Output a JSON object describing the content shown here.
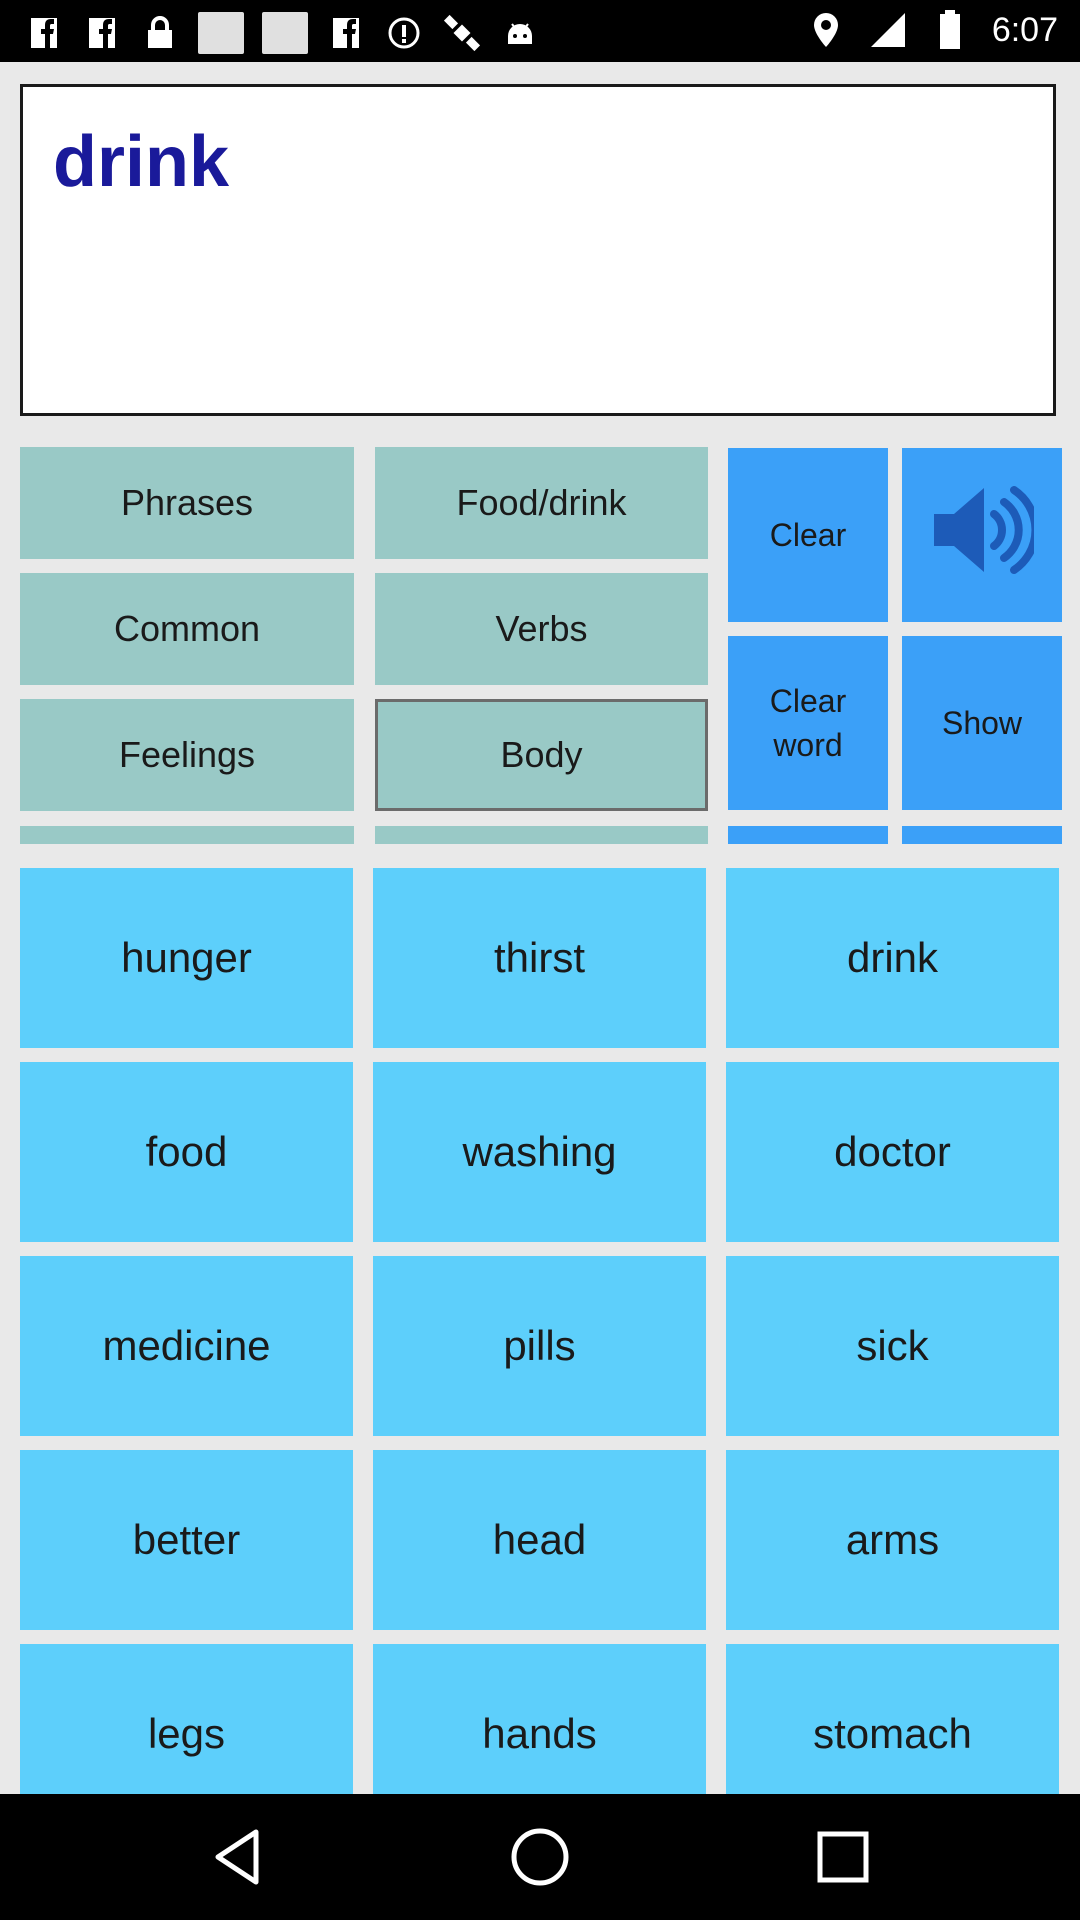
{
  "status_bar": {
    "time": "6:07",
    "icons": [
      "facebook-icon",
      "facebook-icon",
      "lock-icon",
      "image-icon",
      "image-icon",
      "facebook-icon",
      "info-icon",
      "satellite-icon",
      "android-icon",
      "location-icon",
      "signal-icon",
      "battery-icon"
    ]
  },
  "display": {
    "text": "drink"
  },
  "categories": {
    "phrases": "Phrases",
    "food_drink": "Food/drink",
    "common": "Common",
    "verbs": "Verbs",
    "feelings": "Feelings",
    "body": "Body"
  },
  "controls": {
    "clear": "Clear",
    "clear_word_line1": "Clear",
    "clear_word_line2": "word",
    "show": "Show",
    "speaker_icon": "speaker-icon"
  },
  "words": [
    "hunger",
    "thirst",
    "drink",
    "food",
    "washing",
    "doctor",
    "medicine",
    "pills",
    "sick",
    "better",
    "head",
    "arms",
    "legs",
    "hands",
    "stomach"
  ],
  "colors": {
    "category_bg": "#99c9c6",
    "control_bg": "#3ba0f8",
    "word_bg": "#5dcffb",
    "display_text": "#1a1a9a"
  },
  "nav_bar": {
    "icons": [
      "back-icon",
      "home-icon",
      "recents-icon"
    ]
  }
}
